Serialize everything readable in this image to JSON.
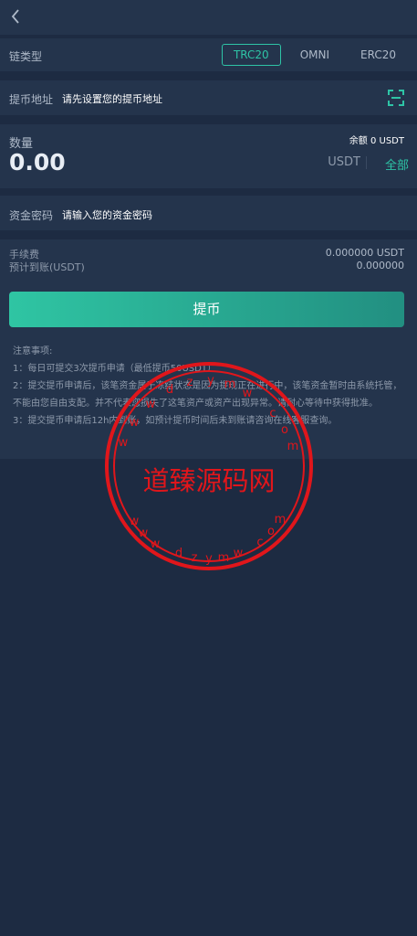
{
  "chain": {
    "label": "链类型",
    "options": [
      "TRC20",
      "OMNI",
      "ERC20"
    ],
    "selected": "TRC20"
  },
  "address": {
    "label": "提币地址",
    "value": "请先设置您的提币地址"
  },
  "amount": {
    "label": "数量",
    "balance": "余额 0 USDT",
    "value": "0.00",
    "unit": "USDT",
    "all_label": "全部"
  },
  "password": {
    "label": "资金密码",
    "placeholder": "请输入您的资金密码"
  },
  "fees": {
    "fee_label": "手续费",
    "fee_value": "0.000000 USDT",
    "arrival_label": "预计到账(USDT)",
    "arrival_value": "0.000000"
  },
  "submit_label": "提币",
  "notes": {
    "title": "注意事项:",
    "items": [
      "1：每日可提交3次提币申请（最低提币50USDT）",
      "2：提交提币申请后，该笔资金属于冻结状态是因为提现正在进行中，该笔资金暂时由系统托管，不能由您自由支配。并不代表您损失了这笔资产或资产出现异常。请耐心等待中获得批准。",
      "3：提交提币申请后12h内到账，如预计提币时间后未到账请咨询在线客服查询。"
    ]
  },
  "watermark": {
    "text": "道臻源码网",
    "ring": "www.dzymw.com",
    "color": "#e0161b"
  },
  "colors": {
    "accent": "#2ec4a6",
    "background": "#1d2b42",
    "card": "#24344c"
  },
  "icons": {
    "back": "back-chevron-icon",
    "scan": "scan-icon"
  }
}
